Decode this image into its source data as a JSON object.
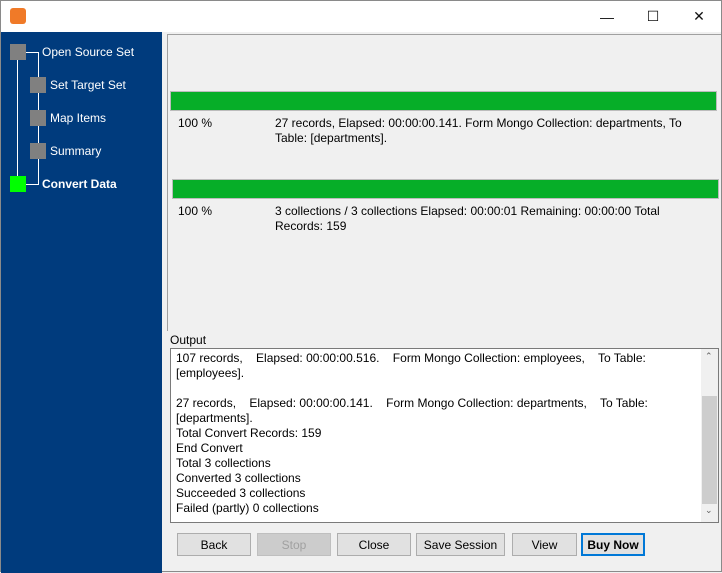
{
  "window": {
    "minimize": "—",
    "maximize": "☐",
    "close": "✕"
  },
  "sidebar": {
    "steps": [
      {
        "label": "Open Source Set",
        "state": "done"
      },
      {
        "label": "Set Target Set",
        "state": "done"
      },
      {
        "label": "Map Items",
        "state": "done"
      },
      {
        "label": "Summary",
        "state": "done"
      },
      {
        "label": "Convert Data",
        "state": "current"
      }
    ],
    "colors": {
      "background": "#003b7d",
      "current": "#00ff00",
      "done": "#808080"
    }
  },
  "progress": [
    {
      "percent_label": "100 %",
      "value": 100,
      "text": "27 records,    Elapsed: 00:00:00.141.    Form Mongo Collection: departments,    To Table: [departments]."
    },
    {
      "percent_label": "100 %",
      "value": 100,
      "text": "3 collections / 3 collections    Elapsed: 00:00:01    Remaining: 00:00:00    Total Records: 159"
    }
  ],
  "output": {
    "label": "Output",
    "lines": "107 records,    Elapsed: 00:00:00.516.    Form Mongo Collection: employees,    To Table: [employees].\n\n27 records,    Elapsed: 00:00:00.141.    Form Mongo Collection: departments,    To Table: [departments].\nTotal Convert Records: 159\nEnd Convert\nTotal 3 collections\nConverted 3 collections\nSucceeded 3 collections\nFailed (partly) 0 collections"
  },
  "buttons": {
    "back": "Back",
    "stop": "Stop",
    "close": "Close",
    "save_session": "Save Session",
    "view": "View",
    "buy_now": "Buy Now"
  }
}
